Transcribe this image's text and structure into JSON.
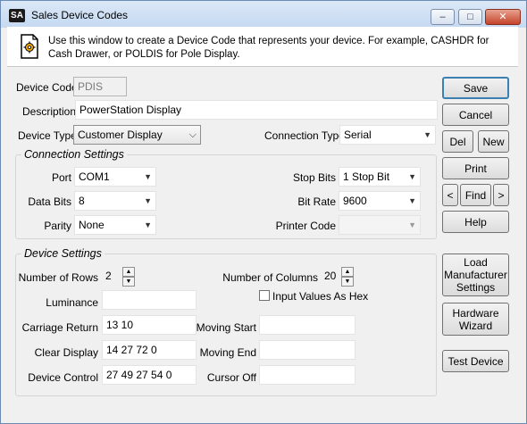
{
  "window": {
    "icon": "SA",
    "title": "Sales Device Codes",
    "minimize": "–",
    "maximize": "□",
    "close": "✕"
  },
  "info": {
    "text": "Use this window to create a Device Code that represents your device. For example, CASHDR for Cash Drawer, or POLDIS for Pole Display."
  },
  "form": {
    "device_code_label": "Device Code",
    "device_code_value": "PDIS",
    "description_label": "Description",
    "description_value": "PowerStation Display",
    "device_type_label": "Device Type",
    "device_type_value": "Customer Display",
    "connection_type_label": "Connection Type",
    "connection_type_value": "Serial"
  },
  "connection_settings": {
    "title": "Connection Settings",
    "port_label": "Port",
    "port_value": "COM1",
    "data_bits_label": "Data Bits",
    "data_bits_value": "8",
    "parity_label": "Parity",
    "parity_value": "None",
    "stop_bits_label": "Stop Bits",
    "stop_bits_value": "1 Stop Bit",
    "bit_rate_label": "Bit Rate",
    "bit_rate_value": "9600",
    "printer_code_label": "Printer Code",
    "printer_code_value": ""
  },
  "device_settings": {
    "title": "Device Settings",
    "rows_label": "Number of Rows",
    "rows_value": "2",
    "columns_label": "Number of Columns",
    "columns_value": "20",
    "luminance_label": "Luminance",
    "luminance_value": "",
    "hex_label": "Input Values As Hex",
    "carriage_return_label": "Carriage Return",
    "carriage_return_value": "13 10",
    "clear_display_label": "Clear Display",
    "clear_display_value": "14 27 72 0",
    "device_control_label": "Device Control",
    "device_control_value": "27 49 27 54 0",
    "moving_start_label": "Moving Start",
    "moving_start_value": "",
    "moving_end_label": "Moving End",
    "moving_end_value": "",
    "cursor_off_label": "Cursor Off",
    "cursor_off_value": ""
  },
  "buttons": {
    "save": "Save",
    "cancel": "Cancel",
    "del": "Del",
    "new": "New",
    "print": "Print",
    "prev": "<",
    "find": "Find",
    "next": ">",
    "help": "Help",
    "load_manufacturer": "Load Manufacturer Settings",
    "hardware_wizard": "Hardware Wizard",
    "test_device": "Test Device"
  }
}
